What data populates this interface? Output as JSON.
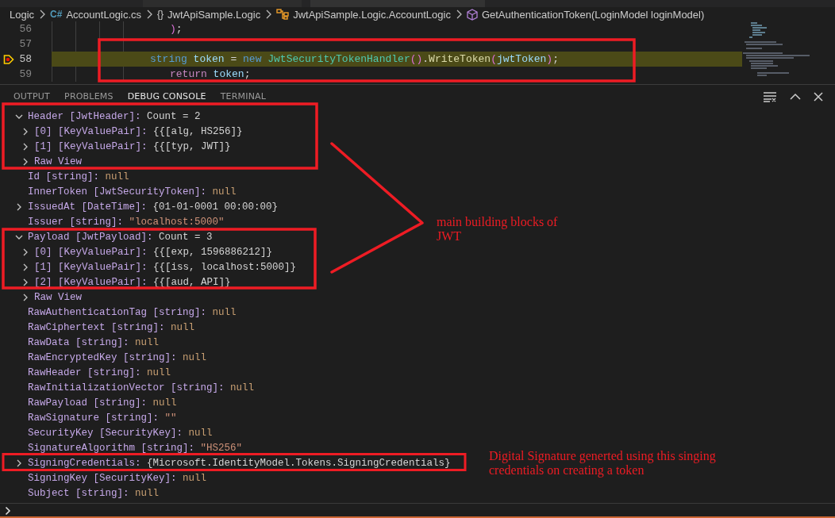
{
  "breadcrumb": [
    {
      "kind": "folder",
      "label": "Logic"
    },
    {
      "kind": "file",
      "icon_text": "C#",
      "label": "AccountLogic.cs"
    },
    {
      "kind": "namespace",
      "icon_text": "{}",
      "label": "JwtApiSample.Logic"
    },
    {
      "kind": "class",
      "label": "JwtApiSample.Logic.AccountLogic"
    },
    {
      "kind": "method",
      "label": "GetAuthenticationToken(LoginModel loginModel)"
    }
  ],
  "editor": {
    "lines": [
      {
        "number": "56",
        "current": false,
        "tokens": [
          {
            "text": ")",
            "kind": "bracket"
          },
          {
            "text": ";",
            "kind": "punct"
          }
        ]
      },
      {
        "number": "57",
        "current": false
      },
      {
        "number": "58",
        "current": true,
        "tokens": [
          {
            "text": "string ",
            "kind": "keyword"
          },
          {
            "text": "token",
            "kind": "variable"
          },
          {
            "text": " = ",
            "kind": "punct"
          },
          {
            "text": "new ",
            "kind": "keyword"
          },
          {
            "text": "JwtSecurityTokenHandler",
            "kind": "class"
          },
          {
            "text": "()",
            "kind": "bracket"
          },
          {
            "text": ".",
            "kind": "punct"
          },
          {
            "text": "WriteToken",
            "kind": "method"
          },
          {
            "text": "(",
            "kind": "bracket"
          },
          {
            "text": "jwtToken",
            "kind": "variable"
          },
          {
            "text": ")",
            "kind": "bracket"
          },
          {
            "text": ";",
            "kind": "punct"
          }
        ]
      },
      {
        "number": "59",
        "current": false,
        "tokens": [
          {
            "text": "return ",
            "kind": "control"
          },
          {
            "text": "token",
            "kind": "variable"
          },
          {
            "text": ";",
            "kind": "punct"
          }
        ]
      }
    ]
  },
  "panel": {
    "tabs": [
      {
        "label": "OUTPUT",
        "selected": false
      },
      {
        "label": "PROBLEMS",
        "selected": false
      },
      {
        "label": "DEBUG CONSOLE",
        "selected": true
      },
      {
        "label": "TERMINAL",
        "selected": false
      }
    ]
  },
  "console": {
    "rows": [
      {
        "label": "Header [JwtHeader]:",
        "value": "Count = 2",
        "kind": "plain",
        "expanded": true,
        "children": [
          {
            "label": "[0] [KeyValuePair]:",
            "value": "{{[alg, HS256]}",
            "kind": "plain",
            "expanded": false
          },
          {
            "label": "[1] [KeyValuePair]:",
            "value": "{{[typ, JWT]}",
            "kind": "plain",
            "expanded": false
          },
          {
            "label": "Raw View",
            "expanded": false
          }
        ]
      },
      {
        "label": "Id [string]:",
        "value": "null",
        "kind": "null"
      },
      {
        "label": "InnerToken [JwtSecurityToken]:",
        "value": "null",
        "kind": "null"
      },
      {
        "label": "IssuedAt [DateTime]:",
        "value": "{01-01-0001 00:00:00}",
        "kind": "plain",
        "expanded": false
      },
      {
        "label": "Issuer [string]:",
        "value": "\"localhost:5000\"",
        "kind": "string"
      },
      {
        "label": "Payload [JwtPayload]:",
        "value": "Count = 3",
        "kind": "plain",
        "expanded": true,
        "children": [
          {
            "label": "[0] [KeyValuePair]:",
            "value": "{{[exp, 1596886212]}",
            "kind": "plain",
            "expanded": false
          },
          {
            "label": "[1] [KeyValuePair]:",
            "value": "{{[iss, localhost:5000]}",
            "kind": "plain",
            "expanded": false
          },
          {
            "label": "[2] [KeyValuePair]:",
            "value": "{{[aud, API]}",
            "kind": "plain",
            "expanded": false
          },
          {
            "label": "Raw View",
            "expanded": false
          }
        ]
      },
      {
        "label": "RawAuthenticationTag [string]:",
        "value": "null",
        "kind": "null"
      },
      {
        "label": "RawCiphertext [string]:",
        "value": "null",
        "kind": "null"
      },
      {
        "label": "RawData [string]:",
        "value": "null",
        "kind": "null"
      },
      {
        "label": "RawEncryptedKey [string]:",
        "value": "null",
        "kind": "null"
      },
      {
        "label": "RawHeader [string]:",
        "value": "null",
        "kind": "null"
      },
      {
        "label": "RawInitializationVector [string]:",
        "value": "null",
        "kind": "null"
      },
      {
        "label": "RawPayload [string]:",
        "value": "null",
        "kind": "null"
      },
      {
        "label": "RawSignature [string]:",
        "value": "\"\"",
        "kind": "string"
      },
      {
        "label": "SecurityKey [SecurityKey]:",
        "value": "null",
        "kind": "null"
      },
      {
        "label": "SignatureAlgorithm [string]:",
        "value": "\"HS256\"",
        "kind": "string"
      },
      {
        "label": "SigningCredentials:",
        "value": "{Microsoft.IdentityModel.Tokens.SigningCredentials}",
        "kind": "plain",
        "expanded": false
      },
      {
        "label": "SigningKey [SecurityKey]:",
        "value": "null",
        "kind": "null"
      },
      {
        "label": "Subject [string]:",
        "value": "null",
        "kind": "null"
      }
    ]
  },
  "annotations": [
    {
      "text": "main building blocks of JWT"
    },
    {
      "text": "Digital Signature generted using this singing credentials on creating a token"
    }
  ]
}
